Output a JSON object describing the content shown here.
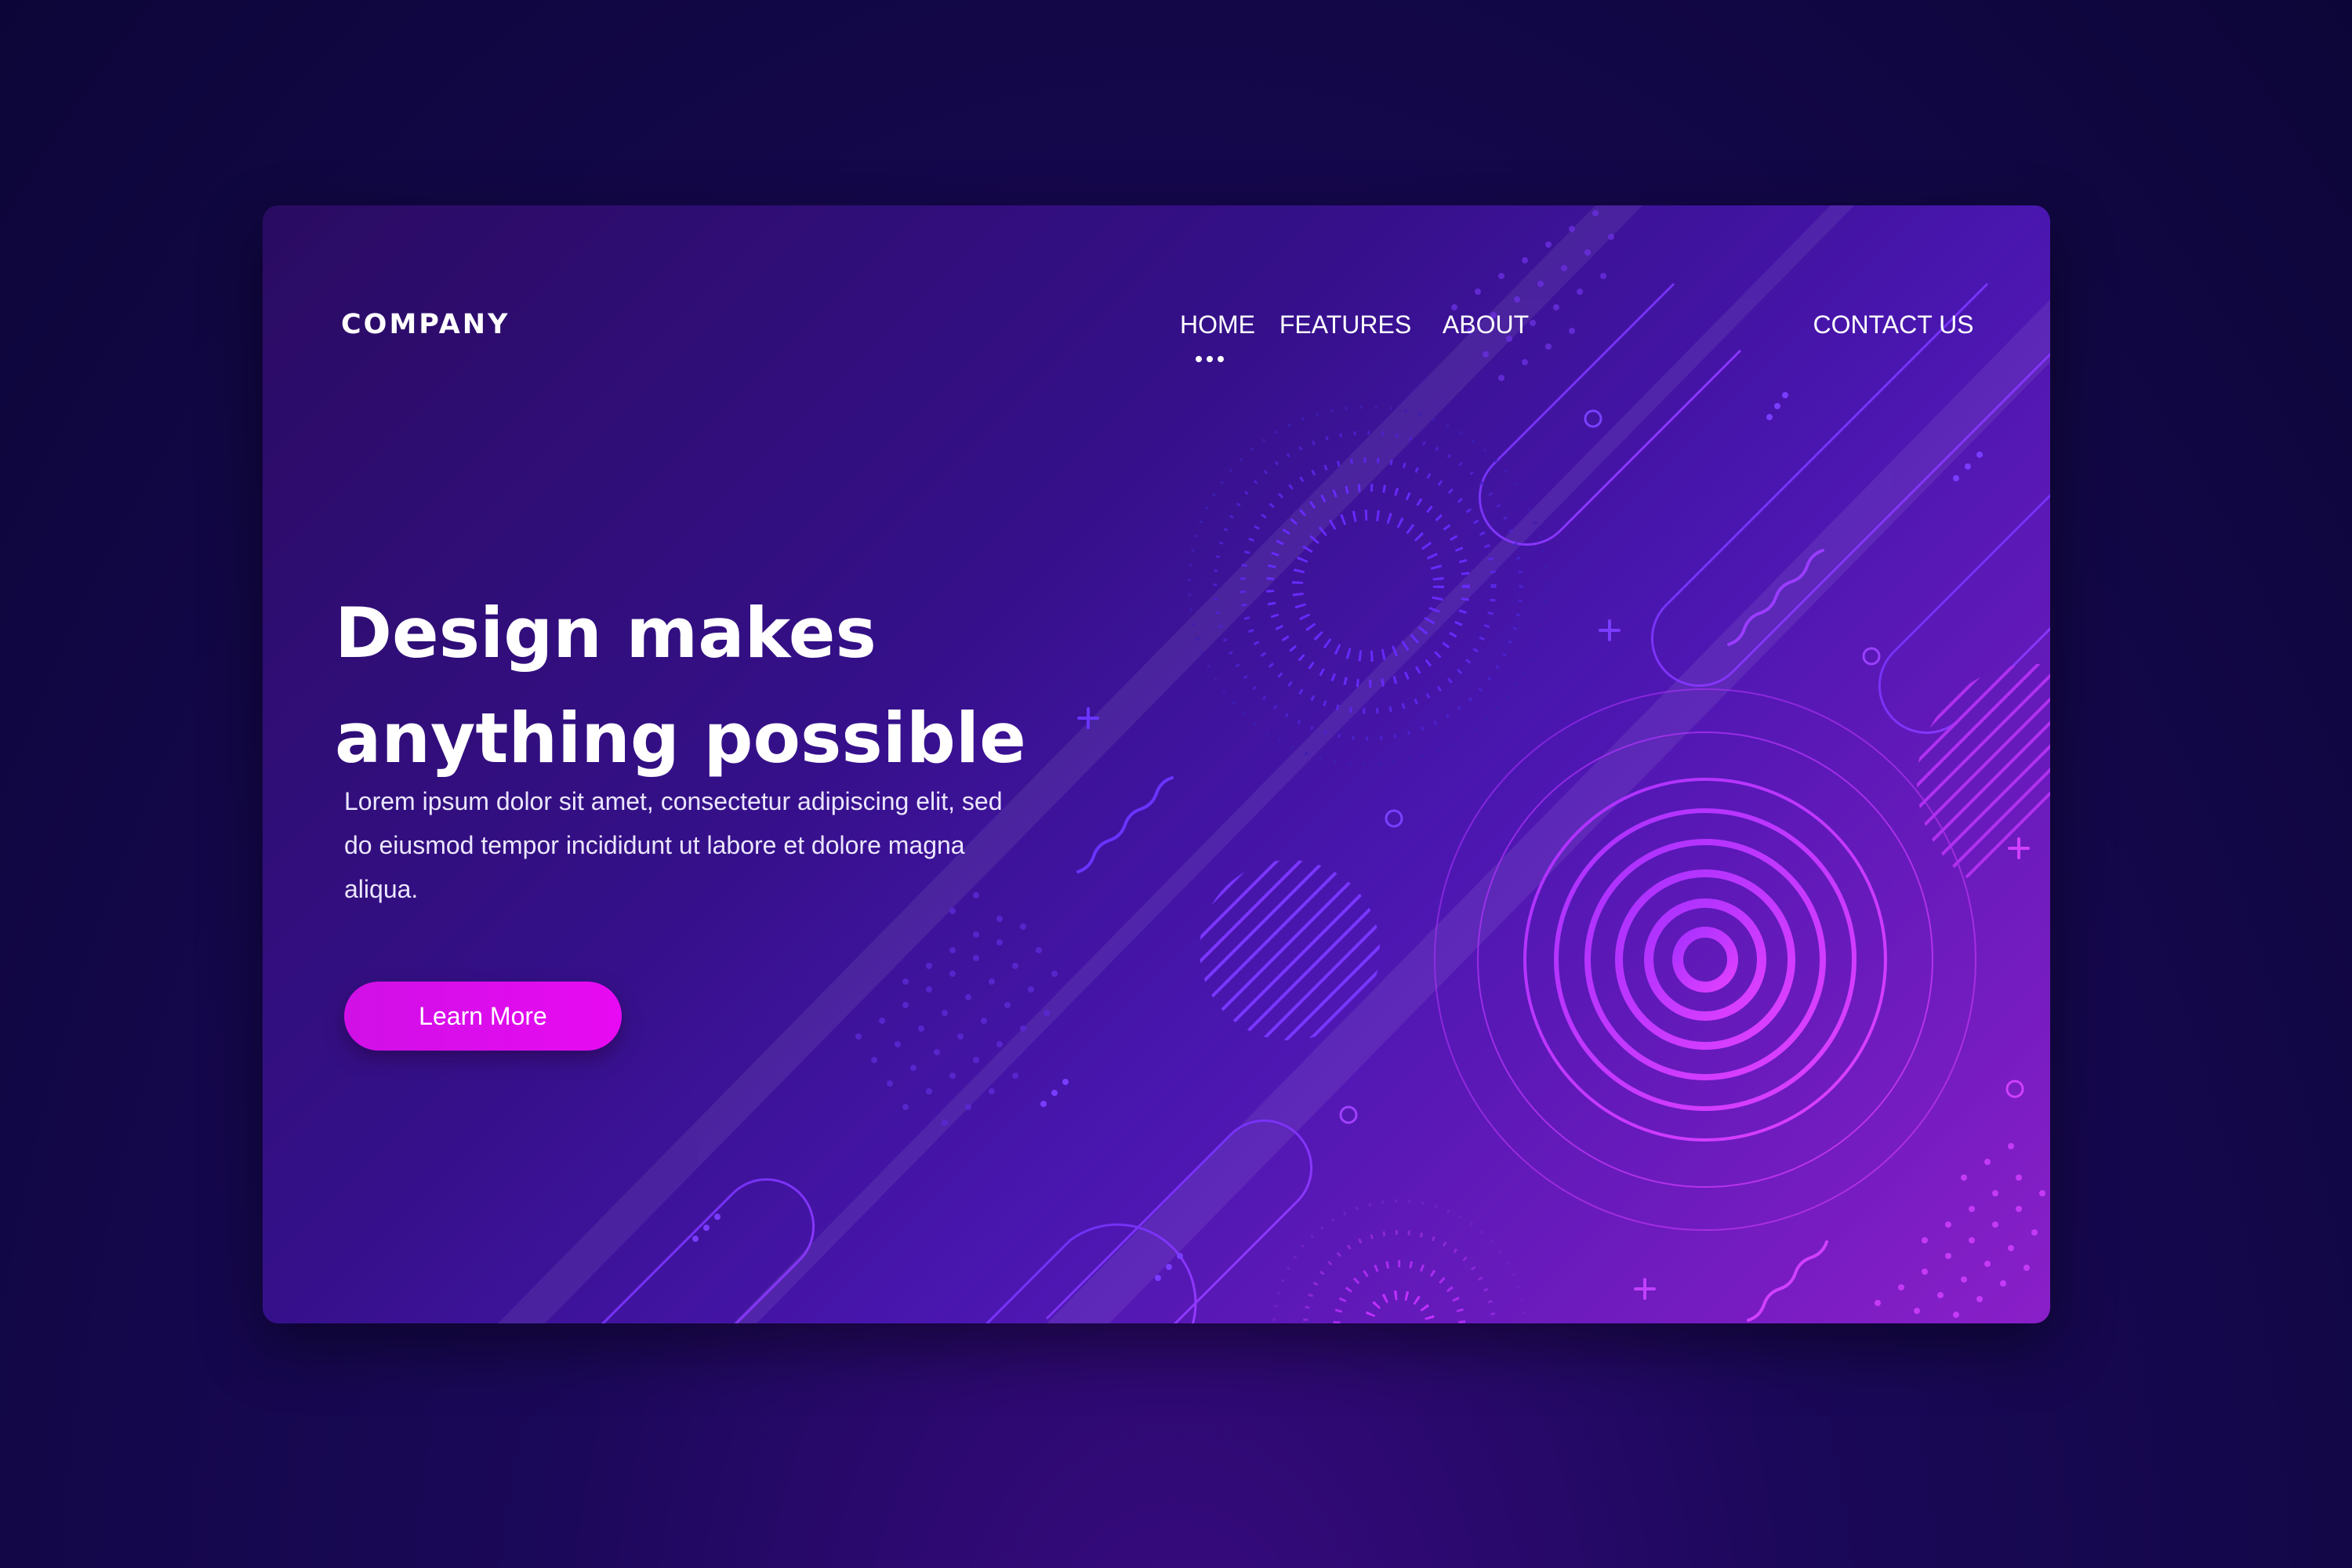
{
  "header": {
    "logo_text": "COMPANY",
    "nav": [
      {
        "label": "HOME",
        "active": true
      },
      {
        "label": "FEATURES",
        "active": false
      },
      {
        "label": "ABOUT",
        "active": false
      },
      {
        "label": "CONTACT US",
        "active": false
      }
    ]
  },
  "hero": {
    "headline_line1": "Design makes",
    "headline_line2": "anything possible",
    "body": "Lorem ipsum dolor sit amet, consectetur adipiscing elit, sed do eiusmod tempor incididunt ut labore et dolore magna aliqua.",
    "cta_label": "Learn More"
  },
  "colors": {
    "background": "#0c0638",
    "card_start": "#2a0b62",
    "card_end": "#8a1fc8",
    "accent": "#e80af2",
    "text": "#ffffff"
  }
}
